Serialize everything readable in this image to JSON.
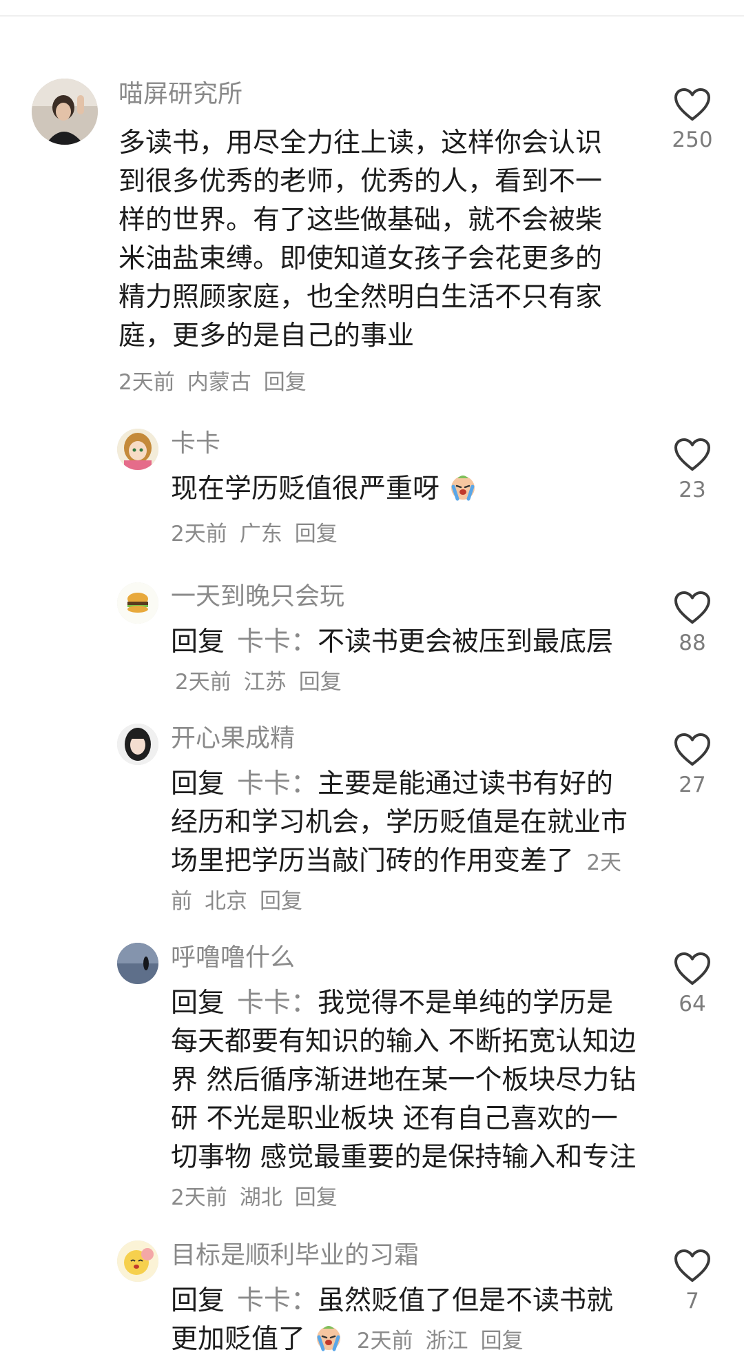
{
  "comments": [
    {
      "user": "喵屏研究所",
      "text": "多读书，用尽全力往上读，这样你会认识到很多优秀的老师，优秀的人，看到不一样的世界。有了这些做基础，就不会被柴米油盐束缚。即使知道女孩子会花更多的精力照顾家庭，也全然明白生活不只有家庭，更多的是自己的事业",
      "time": "2天前",
      "location": "内蒙古",
      "reply_label": "回复",
      "likes": "250"
    },
    {
      "user": "卡卡",
      "text": "现在学历贬值很严重呀",
      "time": "2天前",
      "location": "广东",
      "reply_label": "回复",
      "likes": "23"
    },
    {
      "user": "一天到晚只会玩",
      "reply_prefix": "回复",
      "reply_to": "卡卡：",
      "text": "不读书更会被压到最底层",
      "time": "2天前",
      "location": "江苏",
      "reply_label": "回复",
      "likes": "88"
    },
    {
      "user": "开心果成精",
      "reply_prefix": "回复",
      "reply_to": "卡卡：",
      "text": "主要是能通过读书有好的经历和学习机会，学历贬值是在就业市场里把学历当敲门砖的作用变差了",
      "time": "2天前",
      "location": "北京",
      "reply_label": "回复",
      "likes": "27"
    },
    {
      "user": "呼噜噜什么",
      "reply_prefix": "回复",
      "reply_to": "卡卡：",
      "text": "我觉得不是单纯的学历是每天都要有知识的输入 不断拓宽认知边界 然后循序渐进地在某一个板块尽力钻研 不光是职业板块 还有自己喜欢的一切事物 感觉最重要的是保持输入和专注",
      "time": "2天前",
      "location": "湖北",
      "reply_label": "回复",
      "likes": "64"
    },
    {
      "user": "目标是顺利毕业的习霜",
      "reply_prefix": "回复",
      "reply_to": "卡卡：",
      "text": "虽然贬值了但是不读书就更加贬值了",
      "time": "2天前",
      "location": "浙江",
      "reply_label": "回复",
      "likes": "7"
    }
  ],
  "colors": {
    "meta": "#8a8a8a",
    "text": "#1c1c1c",
    "heart": "#3a3a3a"
  },
  "icons": [
    "heart-icon",
    "crying-emoji-icon"
  ]
}
